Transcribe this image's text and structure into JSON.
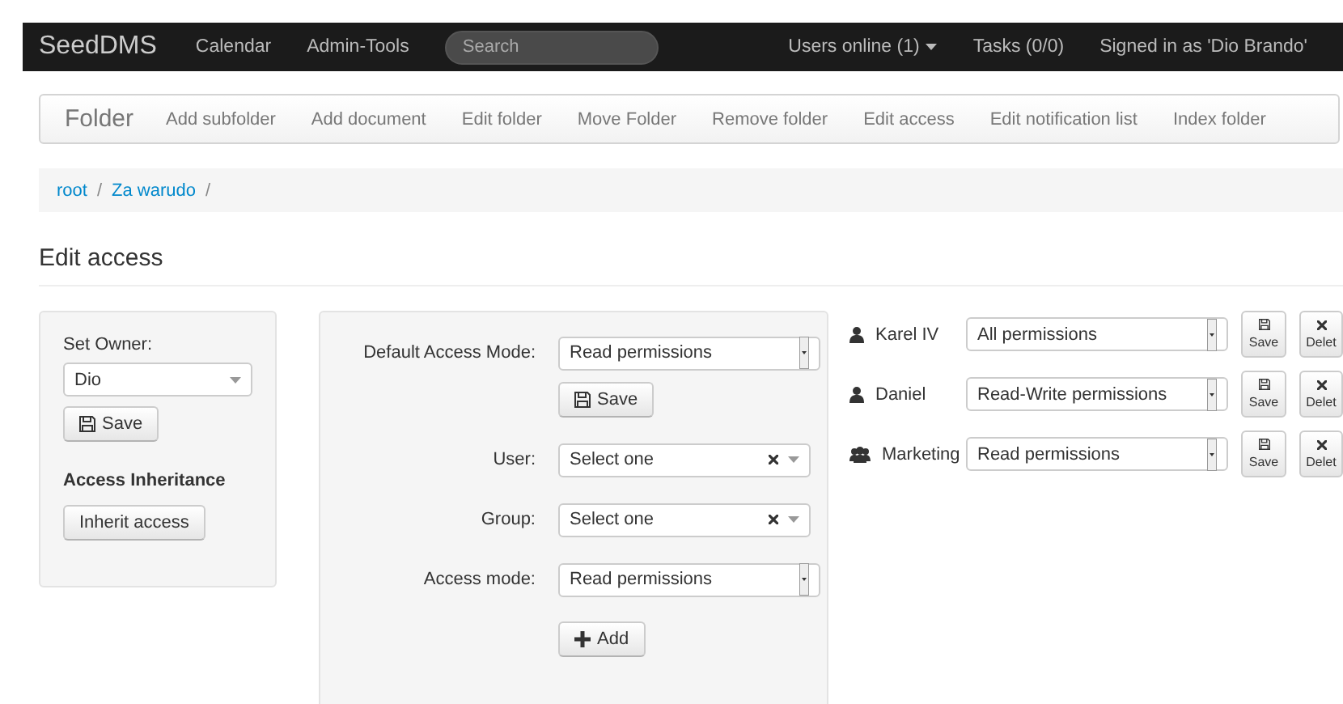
{
  "navbar": {
    "brand": "SeedDMS",
    "links": [
      "Calendar",
      "Admin-Tools"
    ],
    "search": {
      "placeholder": "Search"
    },
    "right": [
      {
        "label": "Users online (1)",
        "dropdown": true
      },
      {
        "label": "Tasks (0/0)",
        "dropdown": false
      },
      {
        "label": "Signed in as 'Dio Brando'",
        "dropdown": false
      }
    ]
  },
  "folder_bar": {
    "title": "Folder",
    "actions": [
      "Add subfolder",
      "Add document",
      "Edit folder",
      "Move Folder",
      "Remove folder",
      "Edit access",
      "Edit notification list",
      "Index folder"
    ]
  },
  "breadcrumb": [
    {
      "label": "root",
      "separator": "/"
    },
    {
      "label": "Za warudo",
      "separator": "/"
    }
  ],
  "heading": "Edit access",
  "owner_panel": {
    "label": "Set Owner:",
    "value": "Dio",
    "save": "Save",
    "inheritance_title": "Access Inheritance",
    "inherit_button": "Inherit access"
  },
  "access_form": {
    "default_label": "Default Access Mode:",
    "default_value": "Read permissions",
    "save": "Save",
    "user_label": "User:",
    "user_placeholder": "Select one",
    "group_label": "Group:",
    "group_placeholder": "Select one",
    "mode_label": "Access mode:",
    "mode_value": "Read permissions",
    "add": "Add"
  },
  "access_list": [
    {
      "kind": "user",
      "name": "Karel IV",
      "mode": "All permissions",
      "save": "Save",
      "delete": "Delet"
    },
    {
      "kind": "user",
      "name": "Daniel",
      "mode": "Read-Write permissions",
      "save": "Save",
      "delete": "Delet"
    },
    {
      "kind": "group",
      "name": "Marketing",
      "mode": "Read permissions",
      "save": "Save",
      "delete": "Delet"
    }
  ]
}
